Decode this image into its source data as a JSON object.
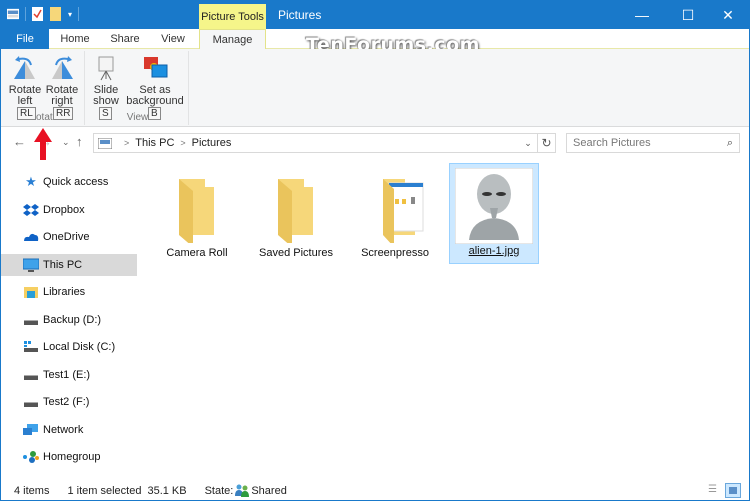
{
  "window": {
    "title": "Pictures",
    "context_tab_header": "Picture Tools",
    "controls": {
      "minimize": "—",
      "maximize": "☐",
      "close": "✕"
    }
  },
  "watermark": "TenForums.com",
  "tabs": [
    {
      "label": "File",
      "active": false
    },
    {
      "label": "Home",
      "active": false
    },
    {
      "label": "Share",
      "active": false
    },
    {
      "label": "View",
      "active": false
    },
    {
      "label": "Manage",
      "active": true
    }
  ],
  "ribbon": {
    "collapse_glyph": "^",
    "help_glyph": "?",
    "groups": [
      {
        "label": "Rotate",
        "buttons": [
          {
            "line1": "Rotate",
            "line2": "left",
            "keytip": "RL",
            "icon": "rotate-left-icon"
          },
          {
            "line1": "Rotate",
            "line2": "right",
            "keytip": "RR",
            "icon": "rotate-right-icon"
          }
        ]
      },
      {
        "label": "View",
        "buttons": [
          {
            "line1": "Slide",
            "line2": "show",
            "keytip": "S",
            "icon": "slideshow-icon"
          },
          {
            "line1": "Set as",
            "line2": "background",
            "keytip": "B",
            "icon": "set-background-icon"
          }
        ]
      }
    ]
  },
  "navigation": {
    "back": "←",
    "forward": "→",
    "recent": "⌄",
    "up": "↑",
    "breadcrumb": [
      "This PC",
      "Pictures"
    ],
    "crumb_separator": ">",
    "dropdown": "⌄",
    "refresh": "↻",
    "search_placeholder": "Search Pictures",
    "search_icon": "⌕"
  },
  "sidebar": {
    "items": [
      {
        "label": "Quick access",
        "icon": "star-icon",
        "selected": false
      },
      {
        "label": "Dropbox",
        "icon": "dropbox-icon",
        "selected": false
      },
      {
        "label": "OneDrive",
        "icon": "cloud-icon",
        "selected": false
      },
      {
        "label": "This PC",
        "icon": "computer-icon",
        "selected": true
      },
      {
        "label": "Libraries",
        "icon": "libraries-icon",
        "selected": false
      },
      {
        "label": "Backup (D:)",
        "icon": "drive-icon",
        "selected": false
      },
      {
        "label": "Local Disk (C:)",
        "icon": "system-drive-icon",
        "selected": false
      },
      {
        "label": "Test1 (E:)",
        "icon": "drive-icon",
        "selected": false
      },
      {
        "label": "Test2 (F:)",
        "icon": "drive-icon",
        "selected": false
      },
      {
        "label": "Network",
        "icon": "network-icon",
        "selected": false
      },
      {
        "label": "Homegroup",
        "icon": "homegroup-icon",
        "selected": false
      }
    ]
  },
  "files": [
    {
      "name": "Camera Roll",
      "type": "folder",
      "selected": false
    },
    {
      "name": "Saved Pictures",
      "type": "folder",
      "selected": false
    },
    {
      "name": "Screenpresso",
      "type": "folder-with-preview",
      "selected": false
    },
    {
      "name": "alien-1.jpg",
      "type": "image",
      "selected": true
    }
  ],
  "status": {
    "item_count": "4 items",
    "selection": "1 item selected",
    "size": "35.1 KB",
    "state_label": "State:",
    "state_value": "Shared"
  },
  "colors": {
    "accent": "#1979ca",
    "context_tab": "#f5f58a",
    "selection": "#cce8ff",
    "annotation_arrow": "#e81123"
  }
}
